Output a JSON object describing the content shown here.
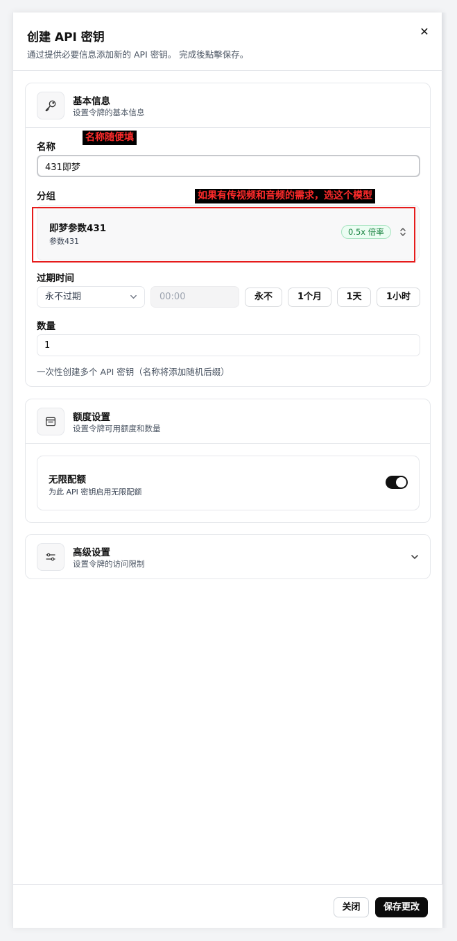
{
  "header": {
    "title": "创建 API 密钥",
    "subtitle": "通过提供必要信息添加新的 API 密钥。 完成後點擊保存。"
  },
  "basic_info": {
    "title": "基本信息",
    "subtitle": "设置令牌的基本信息",
    "name_label": "名称",
    "name_value": "431即梦",
    "group_label": "分组",
    "group": {
      "name": "即梦参数431",
      "description": "参数431",
      "ratio": "0.5x 倍率"
    },
    "expiry_label": "过期时间",
    "expiry_select": "永不过期",
    "expiry_time_placeholder": "00:00",
    "expiry_buttons": [
      "永不",
      "1个月",
      "1天",
      "1小时"
    ],
    "quantity_label": "数量",
    "quantity_value": "1",
    "quantity_help": "一次性创建多个 API 密钥（名称将添加随机后缀）"
  },
  "annotations": {
    "name_note": "名称随便填",
    "group_note": "如果有传视频和音频的需求，选这个模型",
    "highlight_color": "#e61b1b"
  },
  "quota": {
    "title": "额度设置",
    "subtitle": "设置令牌可用额度和数量",
    "unlimited_title": "无限配额",
    "unlimited_desc": "为此 API 密钥启用无限配额",
    "unlimited_enabled": true
  },
  "advanced": {
    "title": "高级设置",
    "subtitle": "设置令牌的访问限制"
  },
  "footer": {
    "close_label": "关闭",
    "save_label": "保存更改"
  }
}
